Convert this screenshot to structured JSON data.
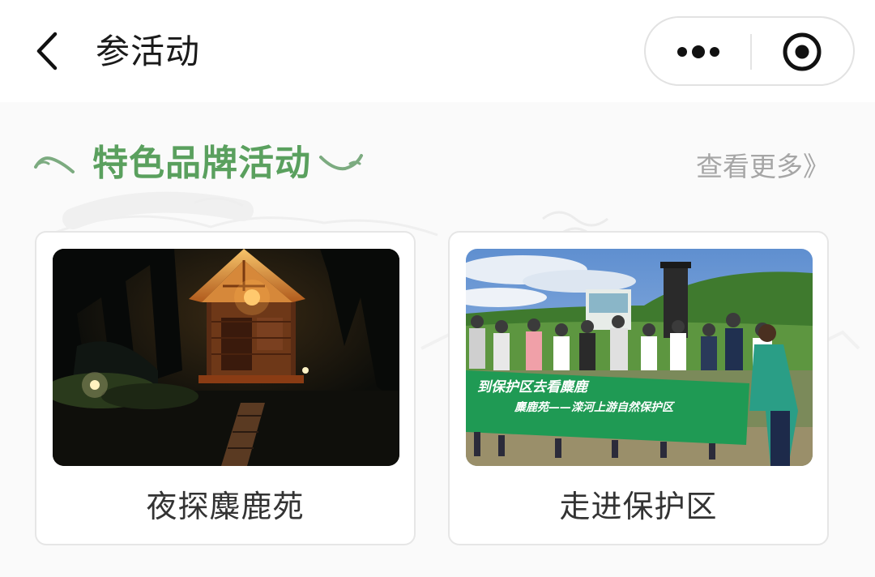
{
  "navbar": {
    "title": "参活动",
    "back_icon": "chevron-left-icon",
    "more_icon": "more-dots-icon",
    "close_icon": "target-circle-icon"
  },
  "section": {
    "title": "特色品牌活动",
    "see_more": "查看更多》",
    "accent_color": "#5aa05e"
  },
  "activities": [
    {
      "caption": "夜探麋鹿苑",
      "image": "night cabin in forest"
    },
    {
      "caption": "走进保护区",
      "image": "group photo with green banner",
      "banner_line1": "到保护区去看麋鹿",
      "banner_line2": "麋鹿苑——滦河上游自然保护区"
    }
  ]
}
